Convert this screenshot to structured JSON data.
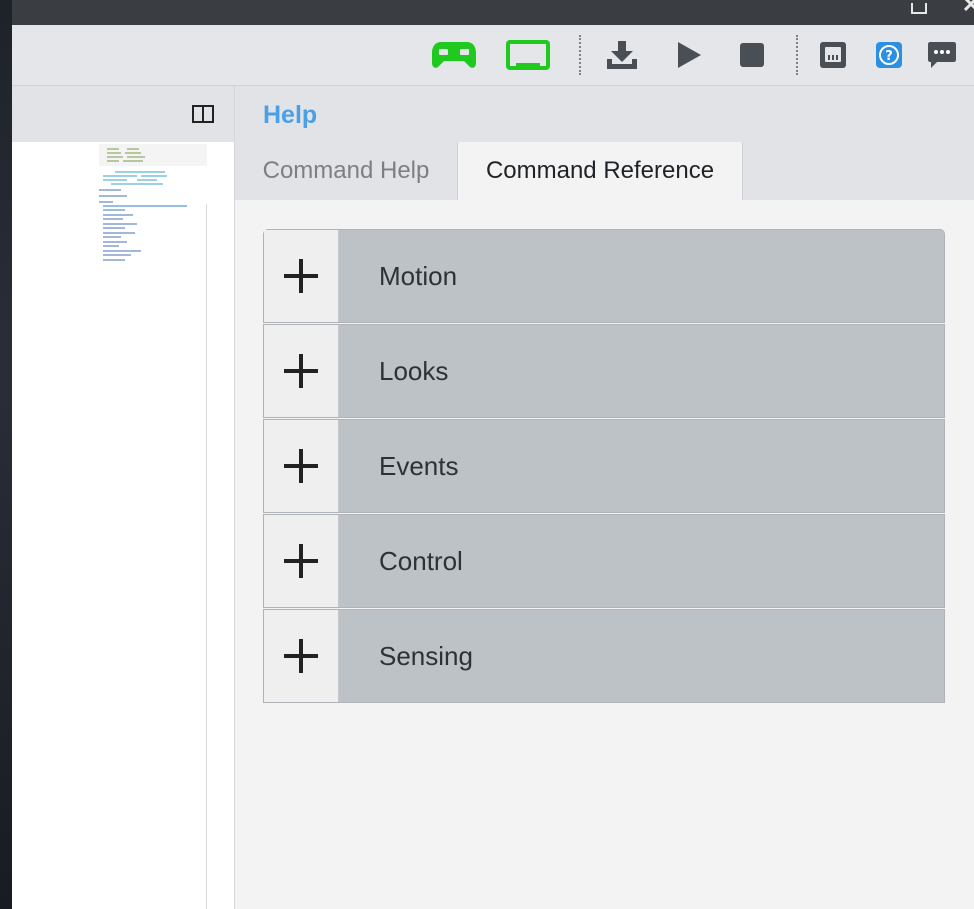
{
  "toolbar": {
    "colors": {
      "accent_green": "#1fc91f",
      "icon_gray": "#4a4f56",
      "help_blue": "#2c8fe0"
    },
    "icons": [
      "gamepad-icon",
      "device-screen-icon",
      "download-icon",
      "play-icon",
      "stop-icon",
      "sd-card-icon",
      "help-icon",
      "chat-icon"
    ]
  },
  "help": {
    "title": "Help",
    "title_color": "#4aa0e6",
    "tabs": [
      {
        "label": "Command Help",
        "active": false
      },
      {
        "label": "Command Reference",
        "active": true
      }
    ],
    "sections": [
      {
        "label": "Motion"
      },
      {
        "label": "Looks"
      },
      {
        "label": "Events"
      },
      {
        "label": "Control"
      },
      {
        "label": "Sensing"
      }
    ]
  }
}
